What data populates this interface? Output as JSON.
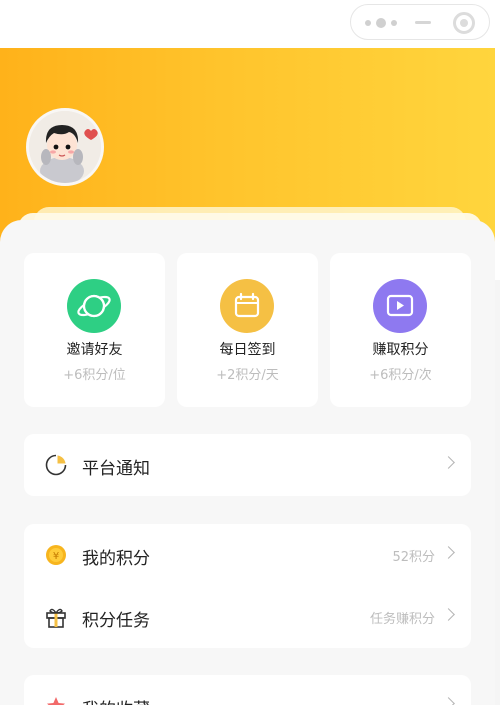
{
  "capsule": {
    "menu_icon": "dots-icon",
    "minimize_icon": "minus-icon",
    "close_icon": "target-icon"
  },
  "header": {
    "colors": {
      "start": "#ffb21a",
      "end": "#ffd53d"
    },
    "avatar_icon": "user-avatar"
  },
  "quick_actions": [
    {
      "title": "邀请好友",
      "sub": "+6积分/位",
      "icon": "planet-icon",
      "color": "#2ecf84"
    },
    {
      "title": "每日签到",
      "sub": "+2积分/天",
      "icon": "calendar-icon",
      "color": "#f5c044"
    },
    {
      "title": "赚取积分",
      "sub": "+6积分/次",
      "icon": "play-video-icon",
      "color": "#8e79f0"
    }
  ],
  "menu": {
    "notice": {
      "label": "平台通知",
      "icon": "pie-chart-icon"
    },
    "points": {
      "label": "我的积分",
      "extra": "52积分",
      "icon": "coin-icon"
    },
    "tasks": {
      "label": "积分任务",
      "extra": "任务赚积分",
      "icon": "gift-icon"
    },
    "favorites": {
      "label": "我的收藏",
      "icon": "star-icon"
    }
  }
}
